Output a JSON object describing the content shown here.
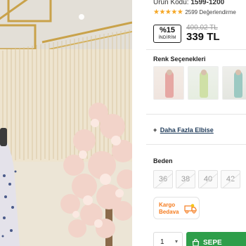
{
  "product": {
    "code_label": "Ürün Kodu:",
    "code_value": "1599-1200",
    "stars": "★★★★★",
    "rating_text": "2599 Değerlendirme"
  },
  "price": {
    "discount_pct": "%15",
    "discount_label": "İNDİRİM",
    "old_price": "400,02 TL",
    "new_price": "339 TL"
  },
  "colors": {
    "title": "Renk Seçenekleri",
    "options": [
      {
        "icon": "dress-pink-thumbnail"
      },
      {
        "icon": "dress-green-thumbnail"
      },
      {
        "icon": "dress-mint-thumbnail"
      }
    ]
  },
  "more": {
    "plus": "+",
    "label": "Daha Fazla Elbise"
  },
  "sizes": {
    "title": "Beden",
    "options": [
      "36",
      "38",
      "40",
      "42"
    ]
  },
  "cargo": {
    "line1": "Kargo",
    "line2": "Bedava",
    "icon": "truck-icon",
    "color": "#f57c1f"
  },
  "cart": {
    "quantity": "1",
    "button_label": "SEPE",
    "button_color": "#2e9e4a"
  }
}
